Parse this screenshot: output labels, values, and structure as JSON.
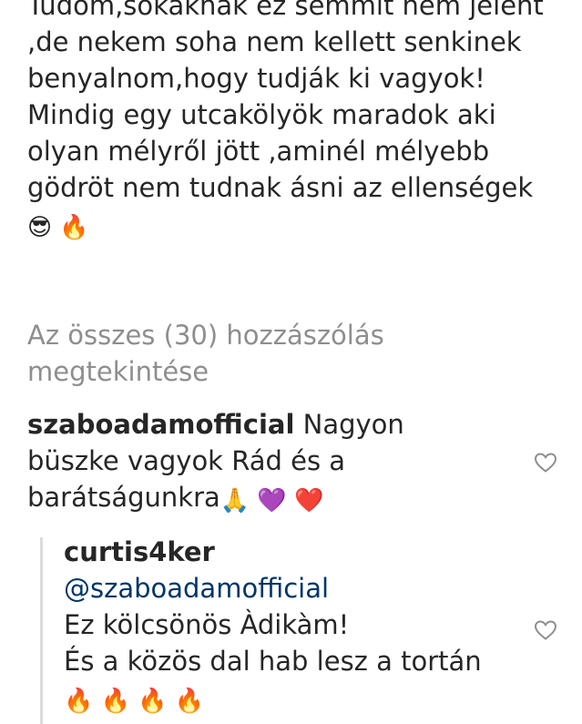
{
  "caption": {
    "text": "Tudom,sokaknak ez semmit nem jelent ,de nekem soha nem kellett senkinek benyalnom,hogy tudják ki vagyok!\nMindig egy utcakölyök maradok aki olyan mélyről jött ,aminél mélyebb gödröt nem tudnak ásni az ellenségek",
    "emojis": "😎 🔥"
  },
  "view_all_comments": "Az összes (30) hozzászólás megtekintése",
  "comment": {
    "username": "szaboadamofficial",
    "text": "Nagyon büszke vagyok Rád és a barátságunkra",
    "emojis": "🙏 💜 ❤️",
    "like_icon": "heart-outline-icon"
  },
  "reply": {
    "username": "curtis4ker",
    "mention": "@szaboadamofficial",
    "text": "Ez kölcsönös Àdikàm!\nÉs a közös dal hab lesz a tortán",
    "emojis": "🔥 🔥 🔥 🔥",
    "like_icon": "heart-outline-icon"
  },
  "colors": {
    "text": "#262626",
    "muted": "#8e8e8e",
    "mention": "#003569",
    "thread_line": "#dbdbdb"
  }
}
